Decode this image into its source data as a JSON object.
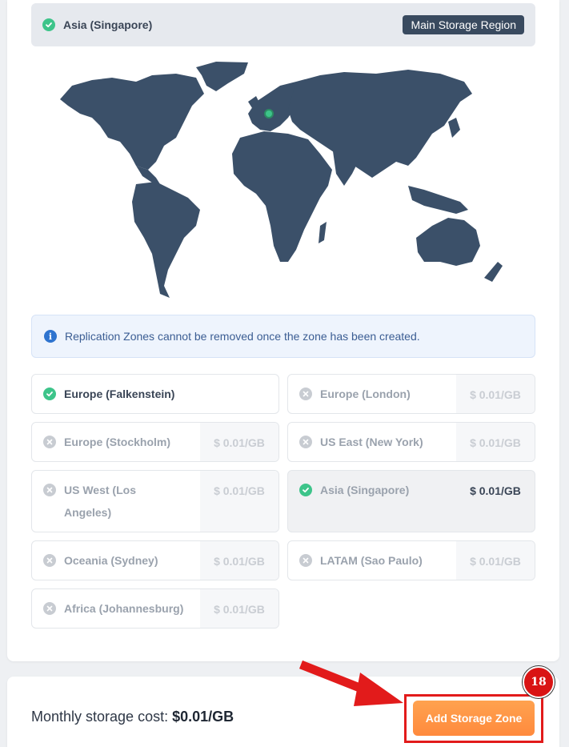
{
  "main_region": {
    "name": "Asia (Singapore)",
    "badge": "Main Storage Region"
  },
  "info": {
    "text": "Replication Zones cannot be removed once the zone has been created."
  },
  "zones": [
    {
      "name": "Europe (Falkenstein)",
      "price": "",
      "state": "active"
    },
    {
      "name": "Europe (London)",
      "price": "$ 0.01/GB",
      "state": "inactive"
    },
    {
      "name": "Europe (Stockholm)",
      "price": "$ 0.01/GB",
      "state": "inactive"
    },
    {
      "name": "US East (New York)",
      "price": "$ 0.01/GB",
      "state": "inactive"
    },
    {
      "name": "US West (Los Angeles)",
      "price": "$ 0.01/GB",
      "state": "inactive"
    },
    {
      "name": "Asia (Singapore)",
      "price": "$ 0.01/GB",
      "state": "selected"
    },
    {
      "name": "Oceania (Sydney)",
      "price": "$ 0.01/GB",
      "state": "inactive"
    },
    {
      "name": "LATAM (Sao Paulo)",
      "price": "$ 0.01/GB",
      "state": "inactive"
    },
    {
      "name": "Africa (Johannesburg)",
      "price": "$ 0.01/GB",
      "state": "inactive"
    }
  ],
  "footer": {
    "cost_label": "Monthly storage cost:",
    "cost_value": "$0.01/GB",
    "add_button": "Add Storage Zone"
  },
  "annotation": {
    "step_number": "18"
  },
  "colors": {
    "map": "#3b5069",
    "check": "#3dc48a",
    "accent_button": "#ff8a3d",
    "highlight": "#e21b1b"
  },
  "icons": {
    "active": "check-circle-icon",
    "inactive": "x-circle-icon",
    "info": "info-icon"
  }
}
